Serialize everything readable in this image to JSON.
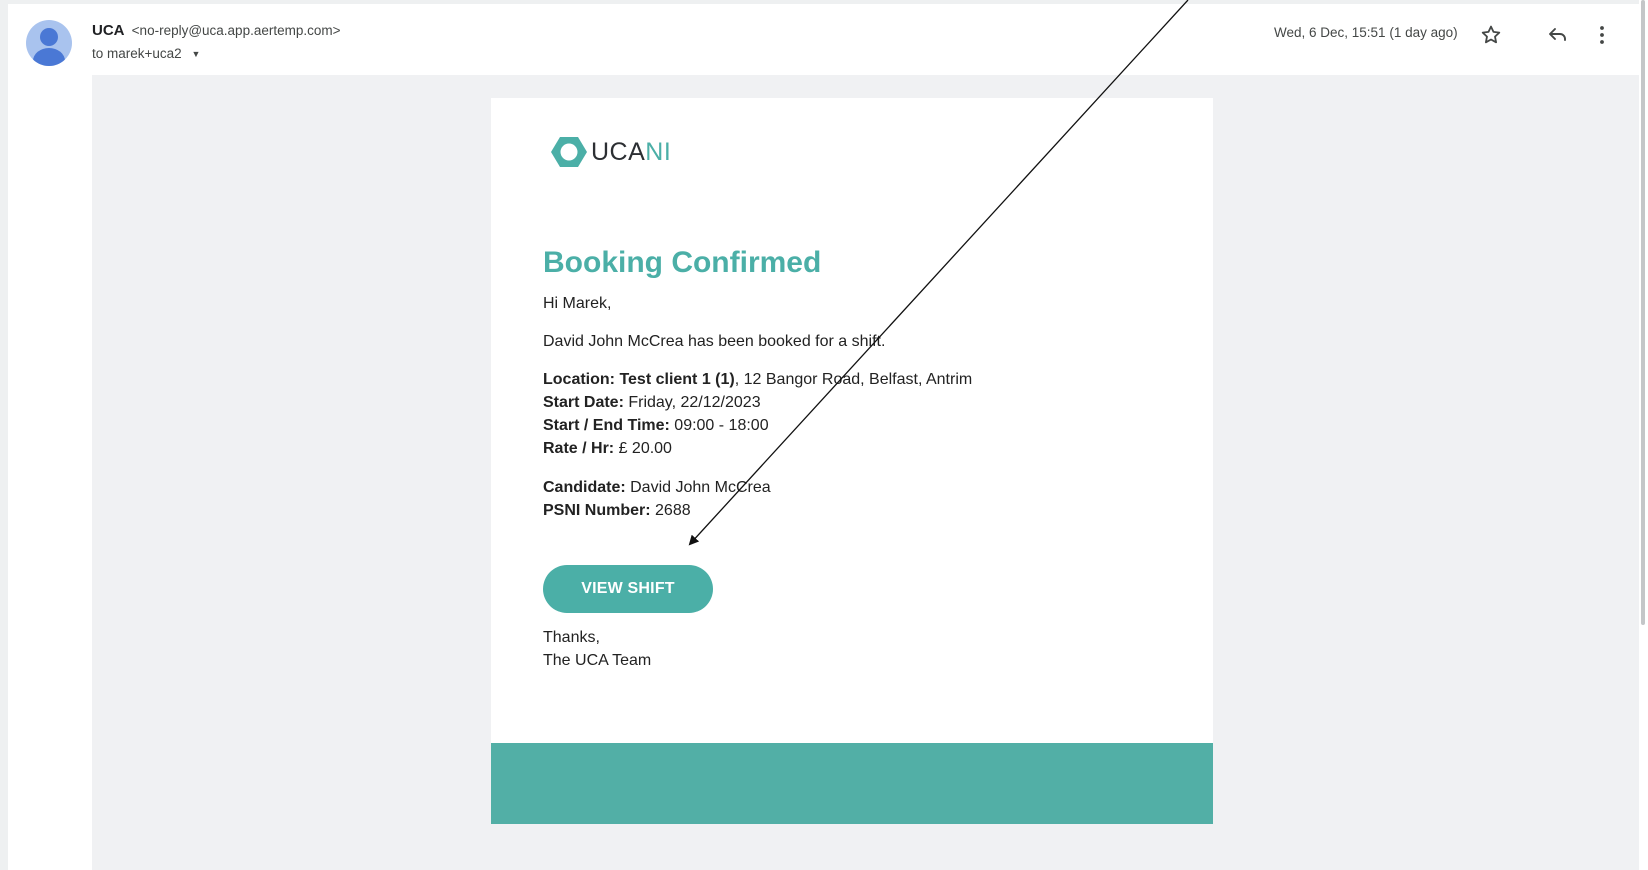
{
  "header": {
    "sender_name": "UCA",
    "sender_email": "<no-reply@uca.app.aertemp.com>",
    "recipient": "to marek+uca2",
    "date": "Wed, 6 Dec, 15:51 (1 day ago)"
  },
  "icons": {
    "avatar": "person-icon",
    "star": "star-icon",
    "reply": "reply-icon",
    "more": "more-vert-icon",
    "recipient_dropdown": "caret-down-icon"
  },
  "email": {
    "logo": {
      "uca": "UCA",
      "ni": "NI"
    },
    "heading": "Booking Confirmed",
    "greeting": "Hi Marek,",
    "intro": "David John McCrea has been booked for a shift.",
    "location_label": "Location: Test client 1 (1)",
    "location_value": ", 12 Bangor Road, Belfast, Antrim",
    "start_date_label": "Start Date:",
    "start_date_value": " Friday, 22/12/2023",
    "time_label": "Start / End Time:",
    "time_value": " 09:00 - 18:00",
    "rate_label": "Rate / Hr:",
    "rate_value": " £ 20.00",
    "candidate_label": "Candidate:",
    "candidate_value": " David John McCrea",
    "psni_label": "PSNI Number:",
    "psni_value": " 2688",
    "button_label": "VIEW SHIFT",
    "thanks": "Thanks,",
    "signature": "The UCA Team"
  },
  "colors": {
    "brand_teal": "#4bafa7",
    "footer_band": "#52afa6",
    "background": "#f0f1f3",
    "avatar": "#4a78d5"
  }
}
